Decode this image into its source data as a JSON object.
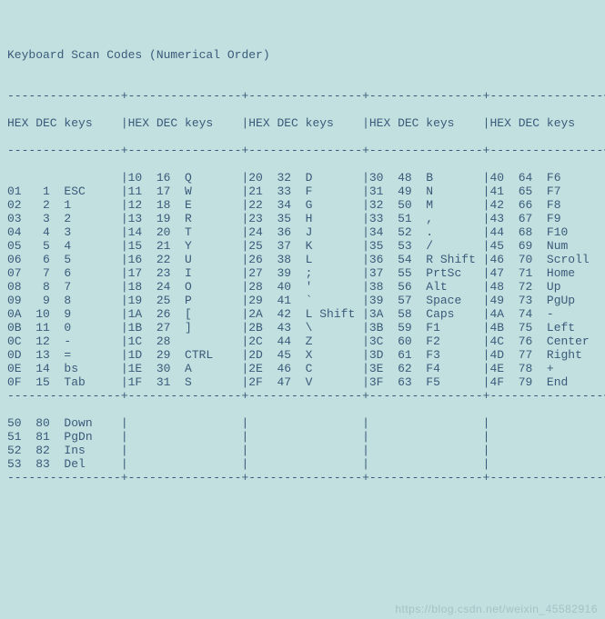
{
  "title": "Keyboard Scan Codes (Numerical Order)",
  "headers": {
    "hex": "HEX",
    "dec": "DEC",
    "keys": "keys"
  },
  "columns": [
    [
      {
        "hex": "",
        "dec": "",
        "key": ""
      },
      {
        "hex": "01",
        "dec": "1",
        "key": "ESC"
      },
      {
        "hex": "02",
        "dec": "2",
        "key": "1"
      },
      {
        "hex": "03",
        "dec": "3",
        "key": "2"
      },
      {
        "hex": "04",
        "dec": "4",
        "key": "3"
      },
      {
        "hex": "05",
        "dec": "5",
        "key": "4"
      },
      {
        "hex": "06",
        "dec": "6",
        "key": "5"
      },
      {
        "hex": "07",
        "dec": "7",
        "key": "6"
      },
      {
        "hex": "08",
        "dec": "8",
        "key": "7"
      },
      {
        "hex": "09",
        "dec": "9",
        "key": "8"
      },
      {
        "hex": "0A",
        "dec": "10",
        "key": "9"
      },
      {
        "hex": "0B",
        "dec": "11",
        "key": "0"
      },
      {
        "hex": "0C",
        "dec": "12",
        "key": "-"
      },
      {
        "hex": "0D",
        "dec": "13",
        "key": "="
      },
      {
        "hex": "0E",
        "dec": "14",
        "key": "bs"
      },
      {
        "hex": "0F",
        "dec": "15",
        "key": "Tab"
      }
    ],
    [
      {
        "hex": "10",
        "dec": "16",
        "key": "Q"
      },
      {
        "hex": "11",
        "dec": "17",
        "key": "W"
      },
      {
        "hex": "12",
        "dec": "18",
        "key": "E"
      },
      {
        "hex": "13",
        "dec": "19",
        "key": "R"
      },
      {
        "hex": "14",
        "dec": "20",
        "key": "T"
      },
      {
        "hex": "15",
        "dec": "21",
        "key": "Y"
      },
      {
        "hex": "16",
        "dec": "22",
        "key": "U"
      },
      {
        "hex": "17",
        "dec": "23",
        "key": "I"
      },
      {
        "hex": "18",
        "dec": "24",
        "key": "O"
      },
      {
        "hex": "19",
        "dec": "25",
        "key": "P"
      },
      {
        "hex": "1A",
        "dec": "26",
        "key": "["
      },
      {
        "hex": "1B",
        "dec": "27",
        "key": "]"
      },
      {
        "hex": "1C",
        "dec": "28",
        "key": ""
      },
      {
        "hex": "1D",
        "dec": "29",
        "key": "CTRL"
      },
      {
        "hex": "1E",
        "dec": "30",
        "key": "A"
      },
      {
        "hex": "1F",
        "dec": "31",
        "key": "S"
      }
    ],
    [
      {
        "hex": "20",
        "dec": "32",
        "key": "D"
      },
      {
        "hex": "21",
        "dec": "33",
        "key": "F"
      },
      {
        "hex": "22",
        "dec": "34",
        "key": "G"
      },
      {
        "hex": "23",
        "dec": "35",
        "key": "H"
      },
      {
        "hex": "24",
        "dec": "36",
        "key": "J"
      },
      {
        "hex": "25",
        "dec": "37",
        "key": "K"
      },
      {
        "hex": "26",
        "dec": "38",
        "key": "L"
      },
      {
        "hex": "27",
        "dec": "39",
        "key": ";"
      },
      {
        "hex": "28",
        "dec": "40",
        "key": "'"
      },
      {
        "hex": "29",
        "dec": "41",
        "key": "`"
      },
      {
        "hex": "2A",
        "dec": "42",
        "key": "L Shift"
      },
      {
        "hex": "2B",
        "dec": "43",
        "key": "\\"
      },
      {
        "hex": "2C",
        "dec": "44",
        "key": "Z"
      },
      {
        "hex": "2D",
        "dec": "45",
        "key": "X"
      },
      {
        "hex": "2E",
        "dec": "46",
        "key": "C"
      },
      {
        "hex": "2F",
        "dec": "47",
        "key": "V"
      }
    ],
    [
      {
        "hex": "30",
        "dec": "48",
        "key": "B"
      },
      {
        "hex": "31",
        "dec": "49",
        "key": "N"
      },
      {
        "hex": "32",
        "dec": "50",
        "key": "M"
      },
      {
        "hex": "33",
        "dec": "51",
        "key": ","
      },
      {
        "hex": "34",
        "dec": "52",
        "key": "."
      },
      {
        "hex": "35",
        "dec": "53",
        "key": "/"
      },
      {
        "hex": "36",
        "dec": "54",
        "key": "R Shift"
      },
      {
        "hex": "37",
        "dec": "55",
        "key": "PrtSc"
      },
      {
        "hex": "38",
        "dec": "56",
        "key": "Alt"
      },
      {
        "hex": "39",
        "dec": "57",
        "key": "Space"
      },
      {
        "hex": "3A",
        "dec": "58",
        "key": "Caps"
      },
      {
        "hex": "3B",
        "dec": "59",
        "key": "F1"
      },
      {
        "hex": "3C",
        "dec": "60",
        "key": "F2"
      },
      {
        "hex": "3D",
        "dec": "61",
        "key": "F3"
      },
      {
        "hex": "3E",
        "dec": "62",
        "key": "F4"
      },
      {
        "hex": "3F",
        "dec": "63",
        "key": "F5"
      }
    ],
    [
      {
        "hex": "40",
        "dec": "64",
        "key": "F6"
      },
      {
        "hex": "41",
        "dec": "65",
        "key": "F7"
      },
      {
        "hex": "42",
        "dec": "66",
        "key": "F8"
      },
      {
        "hex": "43",
        "dec": "67",
        "key": "F9"
      },
      {
        "hex": "44",
        "dec": "68",
        "key": "F10"
      },
      {
        "hex": "45",
        "dec": "69",
        "key": "Num"
      },
      {
        "hex": "46",
        "dec": "70",
        "key": "Scroll"
      },
      {
        "hex": "47",
        "dec": "71",
        "key": "Home"
      },
      {
        "hex": "48",
        "dec": "72",
        "key": "Up"
      },
      {
        "hex": "49",
        "dec": "73",
        "key": "PgUp"
      },
      {
        "hex": "4A",
        "dec": "74",
        "key": "-"
      },
      {
        "hex": "4B",
        "dec": "75",
        "key": "Left"
      },
      {
        "hex": "4C",
        "dec": "76",
        "key": "Center"
      },
      {
        "hex": "4D",
        "dec": "77",
        "key": "Right"
      },
      {
        "hex": "4E",
        "dec": "78",
        "key": "+"
      },
      {
        "hex": "4F",
        "dec": "79",
        "key": "End"
      }
    ]
  ],
  "extra": [
    {
      "hex": "50",
      "dec": "80",
      "key": "Down"
    },
    {
      "hex": "51",
      "dec": "81",
      "key": "PgDn"
    },
    {
      "hex": "52",
      "dec": "82",
      "key": "Ins"
    },
    {
      "hex": "53",
      "dec": "83",
      "key": "Del"
    }
  ],
  "watermark": "https://blog.csdn.net/weixin_45582916"
}
